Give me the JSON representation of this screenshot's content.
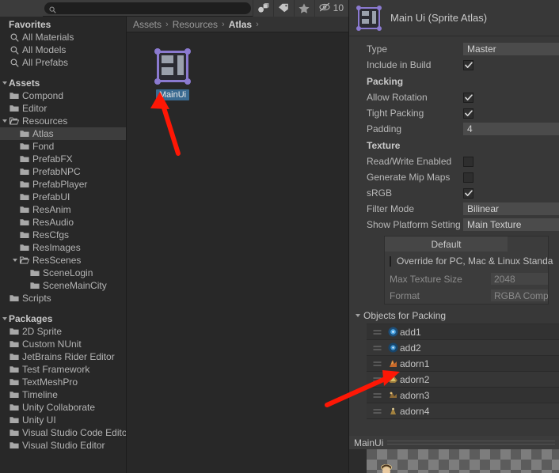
{
  "toolbar": {
    "search_value": "",
    "search_placeholder": "",
    "search_icon": "search-icon",
    "buttons": [
      {
        "name": "asset-type-filter-icon",
        "icon": "sphere-cube-icon"
      },
      {
        "name": "label-filter-icon",
        "icon": "tag-icon"
      },
      {
        "name": "favorite-filter-icon",
        "icon": "star-icon"
      }
    ],
    "hidden_count_icon": "eye-off-icon",
    "hidden_count": "10"
  },
  "tree": {
    "sections": [
      {
        "label": "Favorites",
        "items": [
          {
            "label": "All Materials",
            "icon": "search-icon",
            "indent": 0
          },
          {
            "label": "All Models",
            "icon": "search-icon",
            "indent": 0
          },
          {
            "label": "All Prefabs",
            "icon": "search-icon",
            "indent": 0
          }
        ]
      },
      {
        "label": "Assets",
        "items": [
          {
            "label": "Compond",
            "icon": "folder-icon",
            "indent": 0
          },
          {
            "label": "Editor",
            "icon": "folder-icon",
            "indent": 0
          },
          {
            "label": "Resources",
            "icon": "folder-open-icon",
            "indent": 0,
            "expanded": true
          },
          {
            "label": "Atlas",
            "icon": "folder-icon",
            "indent": 1,
            "selected": true
          },
          {
            "label": "Fond",
            "icon": "folder-icon",
            "indent": 1
          },
          {
            "label": "PrefabFX",
            "icon": "folder-icon",
            "indent": 1
          },
          {
            "label": "PrefabNPC",
            "icon": "folder-icon",
            "indent": 1
          },
          {
            "label": "PrefabPlayer",
            "icon": "folder-icon",
            "indent": 1
          },
          {
            "label": "PrefabUI",
            "icon": "folder-icon",
            "indent": 1
          },
          {
            "label": "ResAnim",
            "icon": "folder-icon",
            "indent": 1
          },
          {
            "label": "ResAudio",
            "icon": "folder-icon",
            "indent": 1
          },
          {
            "label": "ResCfgs",
            "icon": "folder-icon",
            "indent": 1
          },
          {
            "label": "ResImages",
            "icon": "folder-icon",
            "indent": 1
          },
          {
            "label": "ResScenes",
            "icon": "folder-open-icon",
            "indent": 1,
            "expanded": true
          },
          {
            "label": "SceneLogin",
            "icon": "folder-icon",
            "indent": 2
          },
          {
            "label": "SceneMainCity",
            "icon": "folder-icon",
            "indent": 2
          },
          {
            "label": "Scripts",
            "icon": "folder-icon",
            "indent": 0
          }
        ]
      },
      {
        "label": "Packages",
        "items": [
          {
            "label": "2D Sprite",
            "icon": "folder-icon",
            "indent": 0
          },
          {
            "label": "Custom NUnit",
            "icon": "folder-icon",
            "indent": 0
          },
          {
            "label": "JetBrains Rider Editor",
            "icon": "folder-icon",
            "indent": 0
          },
          {
            "label": "Test Framework",
            "icon": "folder-icon",
            "indent": 0
          },
          {
            "label": "TextMeshPro",
            "icon": "folder-icon",
            "indent": 0
          },
          {
            "label": "Timeline",
            "icon": "folder-icon",
            "indent": 0
          },
          {
            "label": "Unity Collaborate",
            "icon": "folder-icon",
            "indent": 0
          },
          {
            "label": "Unity UI",
            "icon": "folder-icon",
            "indent": 0
          },
          {
            "label": "Visual Studio Code Editor",
            "icon": "folder-icon",
            "indent": 0
          },
          {
            "label": "Visual Studio Editor",
            "icon": "folder-icon",
            "indent": 0
          }
        ]
      }
    ]
  },
  "breadcrumb": {
    "items": [
      "Assets",
      "Resources",
      "Atlas"
    ],
    "separator": "›",
    "trailing_separator": "›"
  },
  "grid": {
    "items": [
      {
        "label": "MainUi",
        "icon": "sprite-atlas-icon",
        "selected": true
      }
    ]
  },
  "inspector": {
    "icon": "sprite-atlas-icon",
    "title": "Main Ui (Sprite Atlas)",
    "fields": [
      {
        "kind": "field",
        "label": "Type",
        "value": "Master"
      },
      {
        "kind": "check",
        "label": "Include in Build",
        "checked": true
      }
    ],
    "packing": {
      "header": "Packing",
      "rows": [
        {
          "kind": "check",
          "label": "Allow Rotation",
          "checked": true
        },
        {
          "kind": "check",
          "label": "Tight Packing",
          "checked": true
        },
        {
          "kind": "field",
          "label": "Padding",
          "value": "4"
        }
      ]
    },
    "texture": {
      "header": "Texture",
      "rows": [
        {
          "kind": "check",
          "label": "Read/Write Enabled",
          "checked": false
        },
        {
          "kind": "check",
          "label": "Generate Mip Maps",
          "checked": false
        },
        {
          "kind": "check",
          "label": "sRGB",
          "checked": true
        },
        {
          "kind": "field",
          "label": "Filter Mode",
          "value": "Bilinear"
        },
        {
          "kind": "field",
          "label": "Show Platform Setting",
          "value": "Main Texture"
        }
      ]
    },
    "platform": {
      "tab": "Default",
      "override_label": "Override for PC, Mac & Linux Standa",
      "override_checked": false,
      "rows": [
        {
          "label": "Max Texture Size",
          "value": "2048"
        },
        {
          "label": "Format",
          "value": "RGBA Compress"
        }
      ]
    },
    "objects": {
      "header": "Objects for Packing",
      "expanded": true,
      "items": [
        {
          "label": "add1",
          "icon": "sprite-icon"
        },
        {
          "label": "add2",
          "icon": "sprite-icon"
        },
        {
          "label": "adorn1",
          "icon": "sprite-icon"
        },
        {
          "label": "adorn2",
          "icon": "sprite-icon"
        },
        {
          "label": "adorn3",
          "icon": "sprite-icon"
        },
        {
          "label": "adorn4",
          "icon": "sprite-icon"
        }
      ]
    },
    "preview": {
      "name": "MainUi"
    }
  },
  "annotations": {
    "arrow_color": "#fe1705",
    "arrows": [
      {
        "name": "arrow-to-mainui-asset"
      },
      {
        "name": "arrow-to-add2-row"
      }
    ]
  }
}
